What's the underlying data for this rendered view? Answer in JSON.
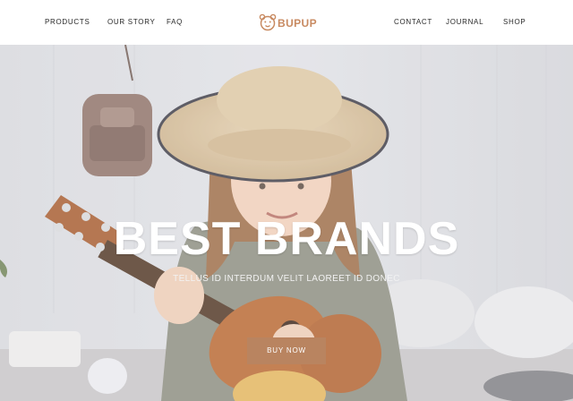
{
  "nav": {
    "left": [
      "PRODUCTS",
      "OUR STORY",
      "FAQ"
    ],
    "right": [
      "CONTACT",
      "JOURNAL",
      "SHOP"
    ]
  },
  "brand": {
    "name": "BUPUP",
    "color": "#c88a61",
    "icon": "bear-face-icon"
  },
  "hero": {
    "title": "BEST BRANDS",
    "subtitle": "TELLUS ID INTERDUM VELIT LAOREET ID DONEC",
    "cta_label": "BUY NOW",
    "cta_color": "#b98460"
  }
}
